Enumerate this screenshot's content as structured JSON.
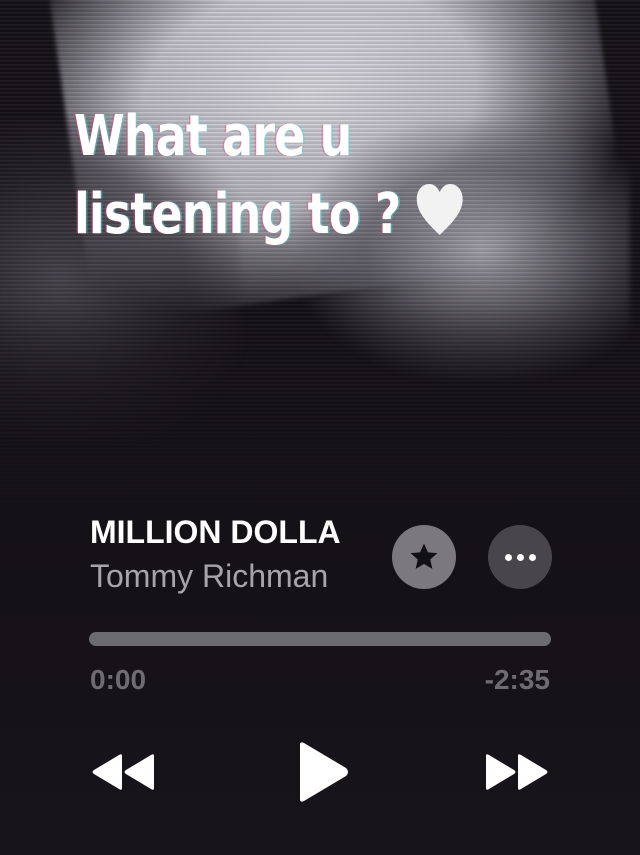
{
  "overlay": {
    "line1": "What are u",
    "line2": "listening to ?",
    "heart_icon": "white-heart-icon"
  },
  "now_playing": {
    "title": "MILLION DOLLA",
    "artist": "Tommy Richman",
    "progress_fraction": 0,
    "elapsed": "0:00",
    "remaining": "-2:35"
  },
  "buttons": {
    "favorite_icon": "star-icon",
    "more_icon": "ellipsis-icon",
    "rewind_icon": "rewind-icon",
    "play_icon": "play-icon",
    "forward_icon": "fast-forward-icon"
  },
  "colors": {
    "background": "#151217",
    "text_primary": "#ffffff",
    "text_secondary": "#a7a5ab",
    "progress_track": "#6d6b72",
    "favorite_button": "#7b787e",
    "more_button": "#48454b"
  }
}
